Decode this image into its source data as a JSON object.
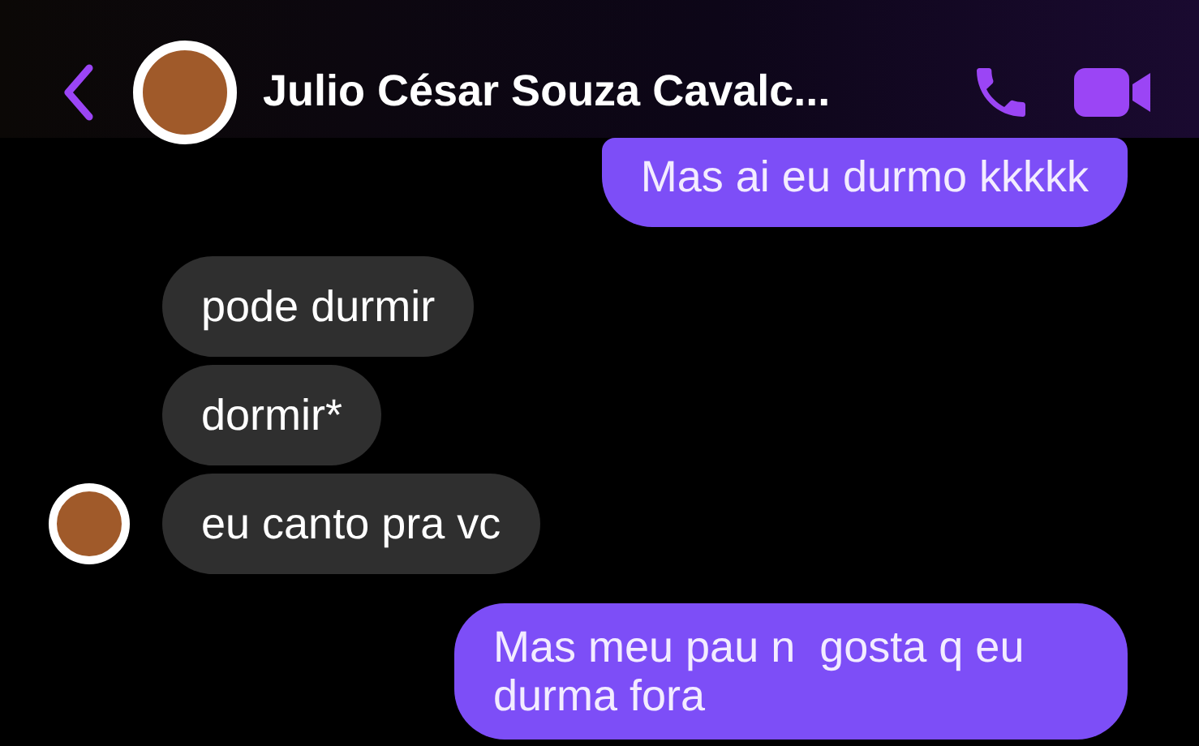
{
  "header": {
    "contact_name": "Julio César Souza Cavalc..."
  },
  "messages": [
    {
      "kind": "sent",
      "text": "Mas ai eu durmo kkkkk"
    },
    {
      "kind": "received",
      "text": "pode durmir",
      "show_avatar": false
    },
    {
      "kind": "received",
      "text": "dormir*",
      "show_avatar": false
    },
    {
      "kind": "received",
      "text": "eu canto pra vc",
      "show_avatar": true
    },
    {
      "kind": "sent",
      "text": "Mas meu pau n  gosta q eu durma fora"
    }
  ]
}
